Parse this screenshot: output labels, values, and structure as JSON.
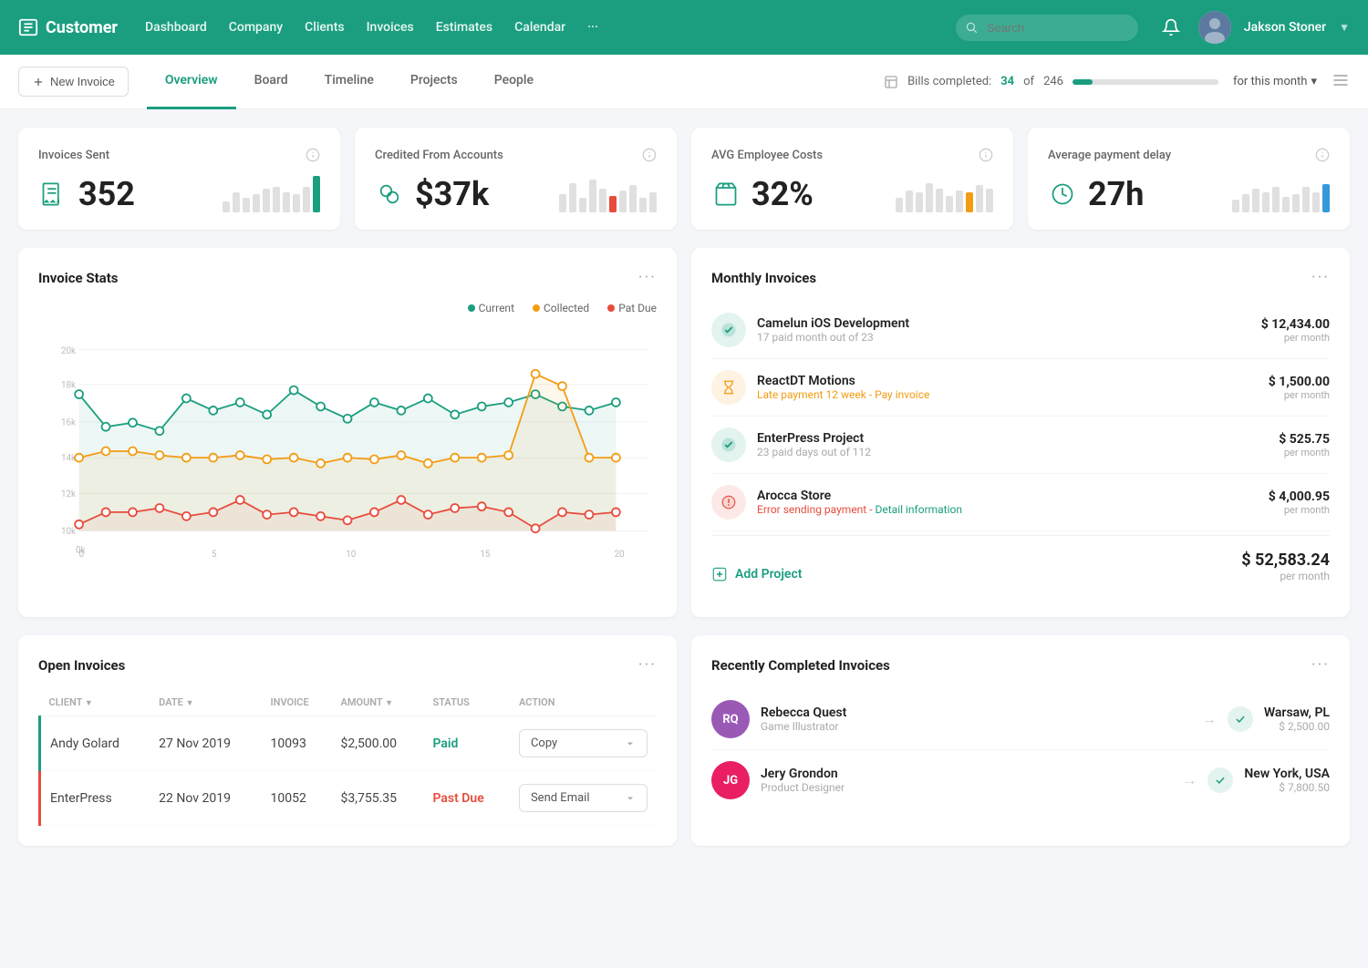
{
  "header": {
    "logo": "Customer",
    "nav": [
      "Dashboard",
      "Company",
      "Clients",
      "Invoices",
      "Estimates",
      "Calendar",
      "···"
    ],
    "search_placeholder": "Search",
    "more": "···",
    "user_name": "Jakson Stoner"
  },
  "sub_nav": {
    "new_invoice": "New Invoice",
    "tabs": [
      "Overview",
      "Board",
      "Timeline",
      "Projects",
      "People"
    ],
    "active_tab": "Overview",
    "bills_label": "Bills completed:",
    "bills_done": "34",
    "bills_total": "246",
    "bills_progress": 13.8,
    "month_label": "for this month"
  },
  "stat_cards": [
    {
      "title": "Invoices Sent",
      "value": "352",
      "icon": "receipt-icon",
      "color": "#1a9e7f",
      "bars": [
        5,
        8,
        6,
        7,
        9,
        10,
        8,
        7,
        10,
        12
      ],
      "highlight": 9,
      "highlight_color": "green"
    },
    {
      "title": "Credited From Accounts",
      "value": "$37k",
      "icon": "coins-icon",
      "color": "#1a9e7f",
      "bars": [
        8,
        12,
        6,
        14,
        10,
        7,
        9,
        11,
        6,
        8
      ],
      "highlight": 5,
      "highlight_color": "red"
    },
    {
      "title": "AVG Employee Costs",
      "value": "32%",
      "icon": "bag-icon",
      "color": "#1a9e7f",
      "bars": [
        6,
        9,
        8,
        12,
        10,
        7,
        9,
        8,
        11,
        10
      ],
      "highlight": 7,
      "highlight_color": "orange"
    },
    {
      "title": "Average payment delay",
      "value": "27h",
      "icon": "clock-icon",
      "color": "#1a9e7f",
      "bars": [
        5,
        7,
        9,
        8,
        10,
        6,
        7,
        10,
        8,
        11
      ],
      "highlight": 9,
      "highlight_color": "blue"
    }
  ],
  "invoice_stats": {
    "title": "Invoice Stats",
    "legend": [
      "Current",
      "Collected",
      "Pat Due"
    ],
    "legend_colors": [
      "#1a9e7f",
      "#f39c12",
      "#e74c3c"
    ],
    "x_labels": [
      "0",
      "5",
      "10",
      "15",
      "20"
    ],
    "y_labels": [
      "0k",
      "12k",
      "14k",
      "16k",
      "18k",
      "20k"
    ]
  },
  "monthly_invoices": {
    "title": "Monthly Invoices",
    "items": [
      {
        "name": "Camelun iOS Development",
        "sub": "17 paid month out of 23",
        "sub_type": "normal",
        "amount": "$ 12,434.00",
        "per": "per month",
        "icon_type": "check",
        "icon_color": "green"
      },
      {
        "name": "ReactDT Motions",
        "sub": "Late payment 12 week - Pay invoice",
        "sub_type": "warning",
        "amount": "$ 1,500.00",
        "per": "per month",
        "icon_type": "hourglass",
        "icon_color": "orange"
      },
      {
        "name": "EnterPress Project",
        "sub": "23 paid days out of 112",
        "sub_type": "normal",
        "amount": "$ 525.75",
        "per": "per month",
        "icon_type": "check",
        "icon_color": "green"
      },
      {
        "name": "Arocca Store",
        "sub": "Error sending payment - Detail information",
        "sub_type": "error",
        "amount": "$ 4,000.95",
        "per": "per month",
        "icon_type": "warning",
        "icon_color": "red"
      }
    ],
    "add_project": "Add Project",
    "total": "$ 52,583.24",
    "total_per": "per month"
  },
  "open_invoices": {
    "title": "Open Invoices",
    "columns": [
      "CLIENT",
      "DATE",
      "INVOICE",
      "AMOUNT",
      "STATUS",
      "ACTION"
    ],
    "rows": [
      {
        "client": "Andy Golard",
        "date": "27 Nov 2019",
        "invoice": "10093",
        "amount": "$2,500.00",
        "status": "Paid",
        "status_type": "paid",
        "action": "Copy"
      },
      {
        "client": "EnterPress",
        "date": "22 Nov 2019",
        "invoice": "10052",
        "amount": "$3,755.35",
        "status": "Past Due",
        "status_type": "pastdue",
        "action": "Send Email"
      }
    ]
  },
  "recently_completed": {
    "title": "Recently Completed Invoices",
    "items": [
      {
        "initials": "RQ",
        "name": "Rebecca Quest",
        "role": "Game Illustrator",
        "location": "Warsaw, PL",
        "amount": "$ 2,500.00",
        "avatar_class": "avatar-rq"
      },
      {
        "initials": "JG",
        "name": "Jery Grondon",
        "role": "Product Designer",
        "location": "New York, USA",
        "amount": "$ 7,800.50",
        "avatar_class": "avatar-jg"
      }
    ]
  }
}
